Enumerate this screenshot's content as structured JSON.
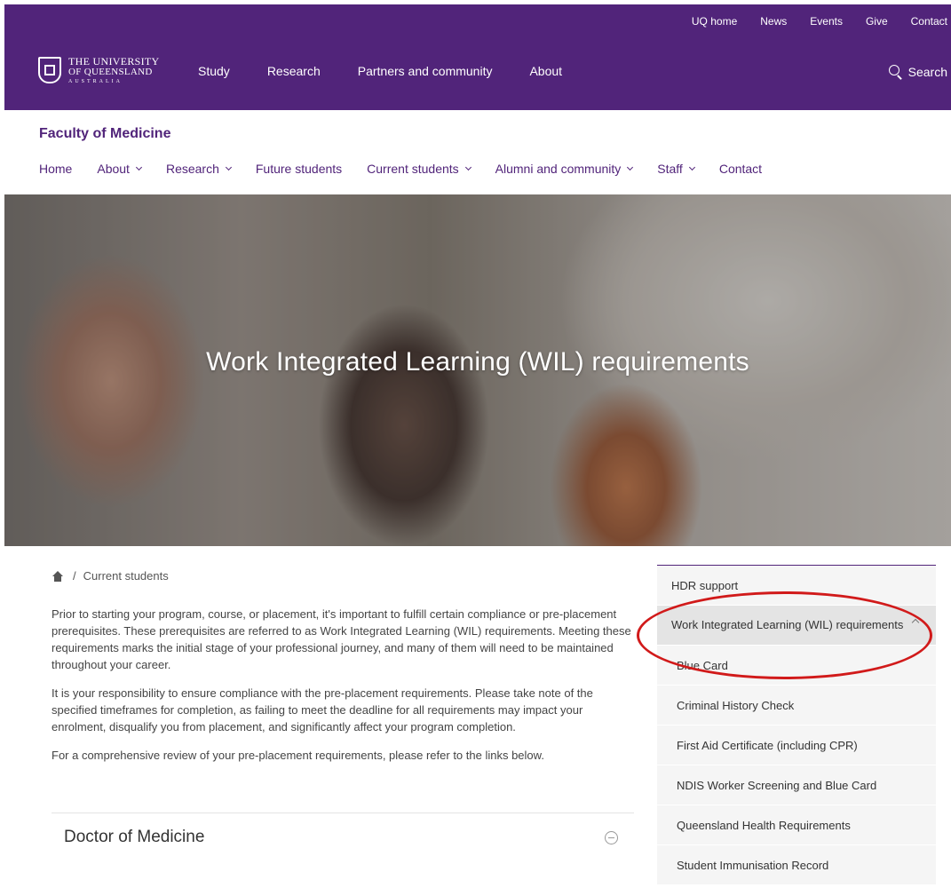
{
  "utility_nav": [
    "UQ home",
    "News",
    "Events",
    "Give",
    "Contact"
  ],
  "logo": {
    "line1": "The University",
    "line2": "of Queensland",
    "line3": "AUSTRALIA"
  },
  "main_nav": [
    "Study",
    "Research",
    "Partners and community",
    "About"
  ],
  "search_label": "Search",
  "site_title": "Faculty of Medicine",
  "site_nav": [
    {
      "label": "Home",
      "has_dropdown": false
    },
    {
      "label": "About",
      "has_dropdown": true
    },
    {
      "label": "Research",
      "has_dropdown": true
    },
    {
      "label": "Future students",
      "has_dropdown": false
    },
    {
      "label": "Current students",
      "has_dropdown": true
    },
    {
      "label": "Alumni and community",
      "has_dropdown": true
    },
    {
      "label": "Staff",
      "has_dropdown": true
    },
    {
      "label": "Contact",
      "has_dropdown": false
    }
  ],
  "hero_title": "Work Integrated Learning (WIL) requirements",
  "breadcrumb": {
    "separator": "/",
    "current": "Current students"
  },
  "content": {
    "paragraphs": [
      "Prior to starting your program, course, or placement, it's important to fulfill certain compliance or pre-placement prerequisites. These prerequisites are referred to as Work Integrated Learning (WIL) requirements. Meeting these requirements marks the initial stage of your professional journey, and many of them will need to be maintained throughout your career.",
      "It is your responsibility to ensure compliance with the pre-placement requirements. Please take note of the specified timeframes for completion, as failing to meet the deadline for all requirements may impact your enrolment, disqualify you from placement, and significantly affect your program completion.",
      "For a comprehensive review of your pre-placement requirements, please refer to the links below."
    ],
    "accordion_title": "Doctor of Medicine"
  },
  "sidebar": {
    "top_item": "HDR support",
    "active_item": "Work Integrated Learning (WIL) requirements",
    "sub_items": [
      "Blue Card",
      "Criminal History Check",
      "First Aid Certificate (including CPR)",
      "NDIS Worker Screening and Blue Card",
      "Queensland Health Requirements",
      "Student Immunisation Record"
    ]
  },
  "colors": {
    "brand_purple": "#51247a",
    "annotation_red": "#d11a1a"
  }
}
